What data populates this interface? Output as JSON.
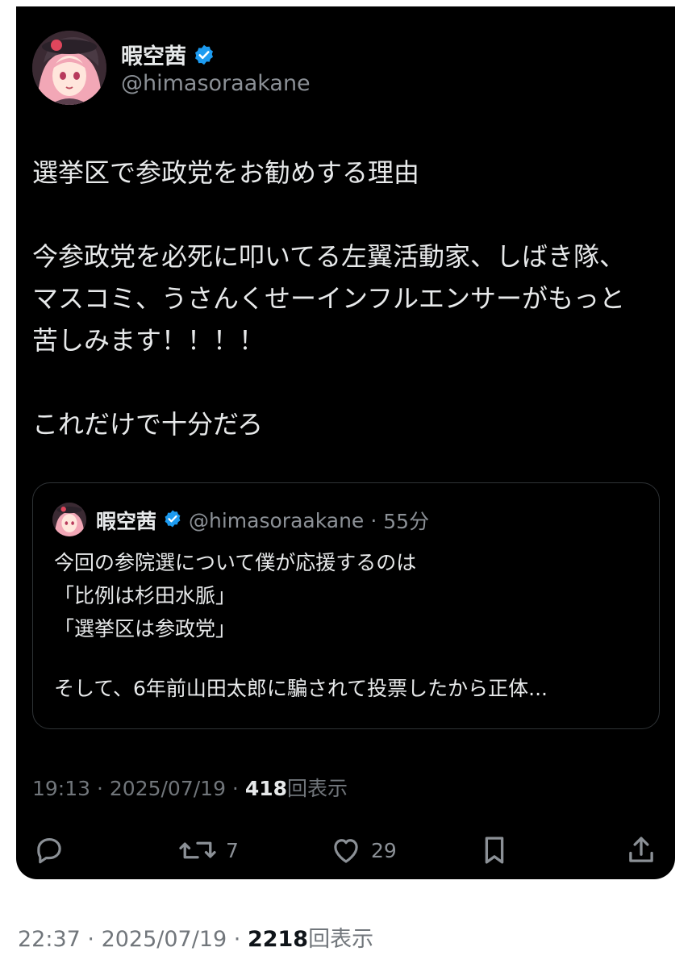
{
  "tweet": {
    "display_name": "暇空茜",
    "handle": "@himasoraakane",
    "verified": true,
    "avatar_icon": "anime-avatar-icon",
    "text_lines": [
      "選挙区で参政党をお勧めする理由",
      "",
      "今参政党を必死に叩いてる左翼活動家、しばき隊、",
      "マスコミ、うさんくせーインフルエンサーがもっと",
      "苦しみます！！！！",
      "",
      "これだけで十分だろ"
    ],
    "time": "19:13",
    "sep1": " · ",
    "date": "2025/07/19",
    "sep2": " · ",
    "views": "418",
    "views_label": "回表示",
    "actions": {
      "reply_icon": "reply-icon",
      "retweet_icon": "retweet-icon",
      "retweet_count": "7",
      "like_icon": "heart-icon",
      "like_count": "29",
      "bookmark_icon": "bookmark-icon",
      "share_icon": "share-icon"
    }
  },
  "quoted_tweet": {
    "display_name": "暇空茜",
    "handle": "@himasoraakane",
    "sep": "·",
    "time_ago": "55分",
    "text_lines": [
      "今回の参院選について僕が応援するのは",
      "「比例は杉田水脈」",
      "「選挙区は参政党」",
      "",
      "そして、6年前山田太郎に騙されて投票したから正体..."
    ]
  },
  "outer_meta": {
    "time": "22:37",
    "sep1": " · ",
    "date": "2025/07/19",
    "sep2": " · ",
    "views": "2218",
    "views_label": "回表示"
  },
  "colors": {
    "background": "#000000",
    "text": "#e7e9ea",
    "secondary": "#8b9096",
    "verified": "#1d9bf0",
    "border": "#2f3336"
  }
}
